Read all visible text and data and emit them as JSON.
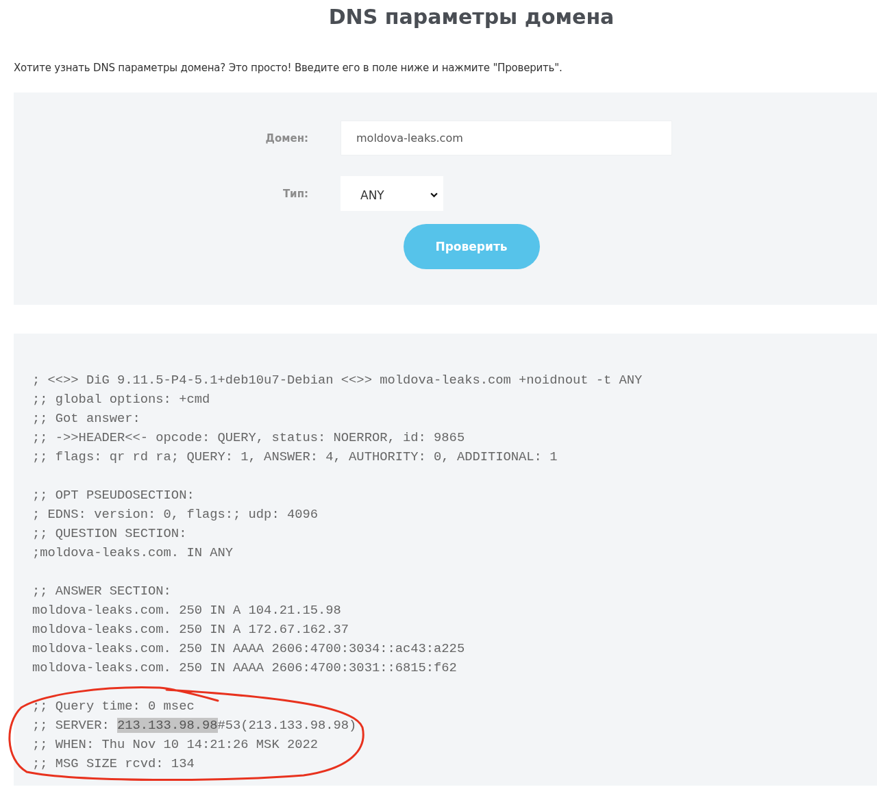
{
  "page": {
    "title": "DNS параметры домена",
    "intro": "Хотите узнать DNS параметры домена? Это просто! Введите его в поле ниже и нажмите \"Проверить\"."
  },
  "form": {
    "domain_label": "Домен:",
    "domain_value": "moldova-leaks.com",
    "type_label": "Тип:",
    "type_value": "ANY",
    "submit": "Проверить"
  },
  "output": {
    "blocks": [
      {
        "lines": [
          {
            "text": "; <<>> DiG 9.11.5-P4-5.1+deb10u7-Debian <<>> moldova-leaks.com +noidnout -t ANY"
          },
          {
            "text": ";; global options: +cmd"
          },
          {
            "text": ";; Got answer:"
          },
          {
            "text": ";; ->>HEADER<<- opcode: QUERY, status: NOERROR, id: 9865"
          },
          {
            "text": ";; flags: qr rd ra; QUERY: 1, ANSWER: 4, AUTHORITY: 0, ADDITIONAL: 1"
          }
        ]
      },
      {
        "lines": [
          {
            "text": ";; OPT PSEUDOSECTION:"
          },
          {
            "text": "; EDNS: version: 0, flags:; udp: 4096"
          },
          {
            "text": ";; QUESTION SECTION:"
          },
          {
            "text": ";moldova-leaks.com. IN ANY"
          }
        ]
      },
      {
        "lines": [
          {
            "text": ";; ANSWER SECTION:"
          },
          {
            "text": "moldova-leaks.com. 250 IN A 104.21.15.98"
          },
          {
            "text": "moldova-leaks.com. 250 IN A 172.67.162.37"
          },
          {
            "text": "moldova-leaks.com. 250 IN AAAA 2606:4700:3034::ac43:a225"
          },
          {
            "text": "moldova-leaks.com. 250 IN AAAA 2606:4700:3031::6815:f62"
          }
        ]
      },
      {
        "circled": true,
        "lines": [
          {
            "text": ";; Query time: 0 msec"
          },
          {
            "segments": [
              {
                "text": ";; SERVER: ",
                "highlighted": false
              },
              {
                "text": "213.133.98.98",
                "highlighted": true
              },
              {
                "text": "#53(213.133.98.98)",
                "highlighted": false
              }
            ]
          },
          {
            "text": ";; WHEN: Thu Nov 10 14:21:26 MSK 2022"
          },
          {
            "text": ";; MSG SIZE rcvd: 134"
          }
        ]
      }
    ]
  }
}
